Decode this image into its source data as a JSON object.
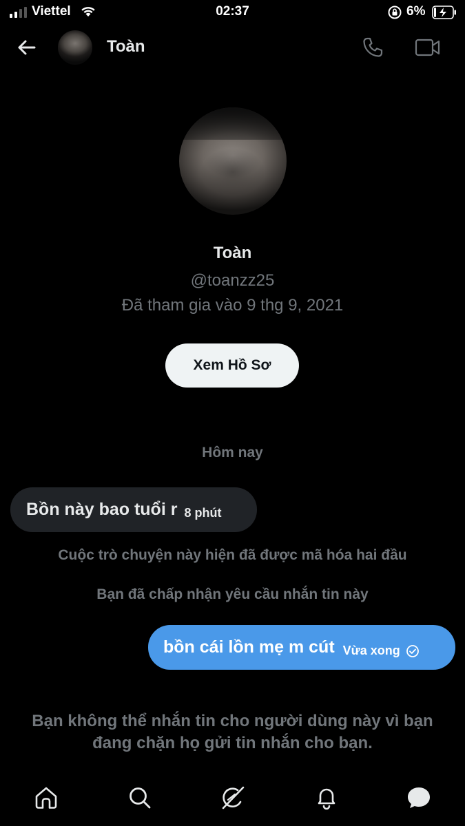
{
  "status_bar": {
    "carrier": "Viettel",
    "time": "02:37",
    "battery": "6%"
  },
  "header": {
    "title": "Toàn"
  },
  "profile": {
    "name": "Toàn",
    "handle": "@toanzz25",
    "joined": "Đã tham gia vào 9 thg 9, 2021",
    "view_profile_button": "Xem Hồ Sơ"
  },
  "conversation": {
    "date_separator": "Hôm nay",
    "messages": [
      {
        "direction": "incoming",
        "text": "Bồn này bao tuổi r",
        "time": "8 phút"
      },
      {
        "direction": "outgoing",
        "text": "bồn cái lồn mẹ m cút",
        "time": "Vừa xong"
      }
    ],
    "system_notes": [
      "Cuộc trò chuyện này hiện đã được mã hóa hai đầu",
      "Bạn đã chấp nhận yêu cầu nhắn tin này"
    ],
    "blocked_notice": "Bạn không thể nhắn tin cho người dùng này vì bạn đang chặn họ gửi tin nhắn cho bạn."
  },
  "tab_bar": [
    "home-icon",
    "search-icon",
    "grok-icon",
    "notifications-icon",
    "messages-icon"
  ],
  "colors": {
    "background": "#000000",
    "outgoing_bubble": "#4a99e9",
    "incoming_bubble": "#202327",
    "muted_text": "#71767b"
  }
}
